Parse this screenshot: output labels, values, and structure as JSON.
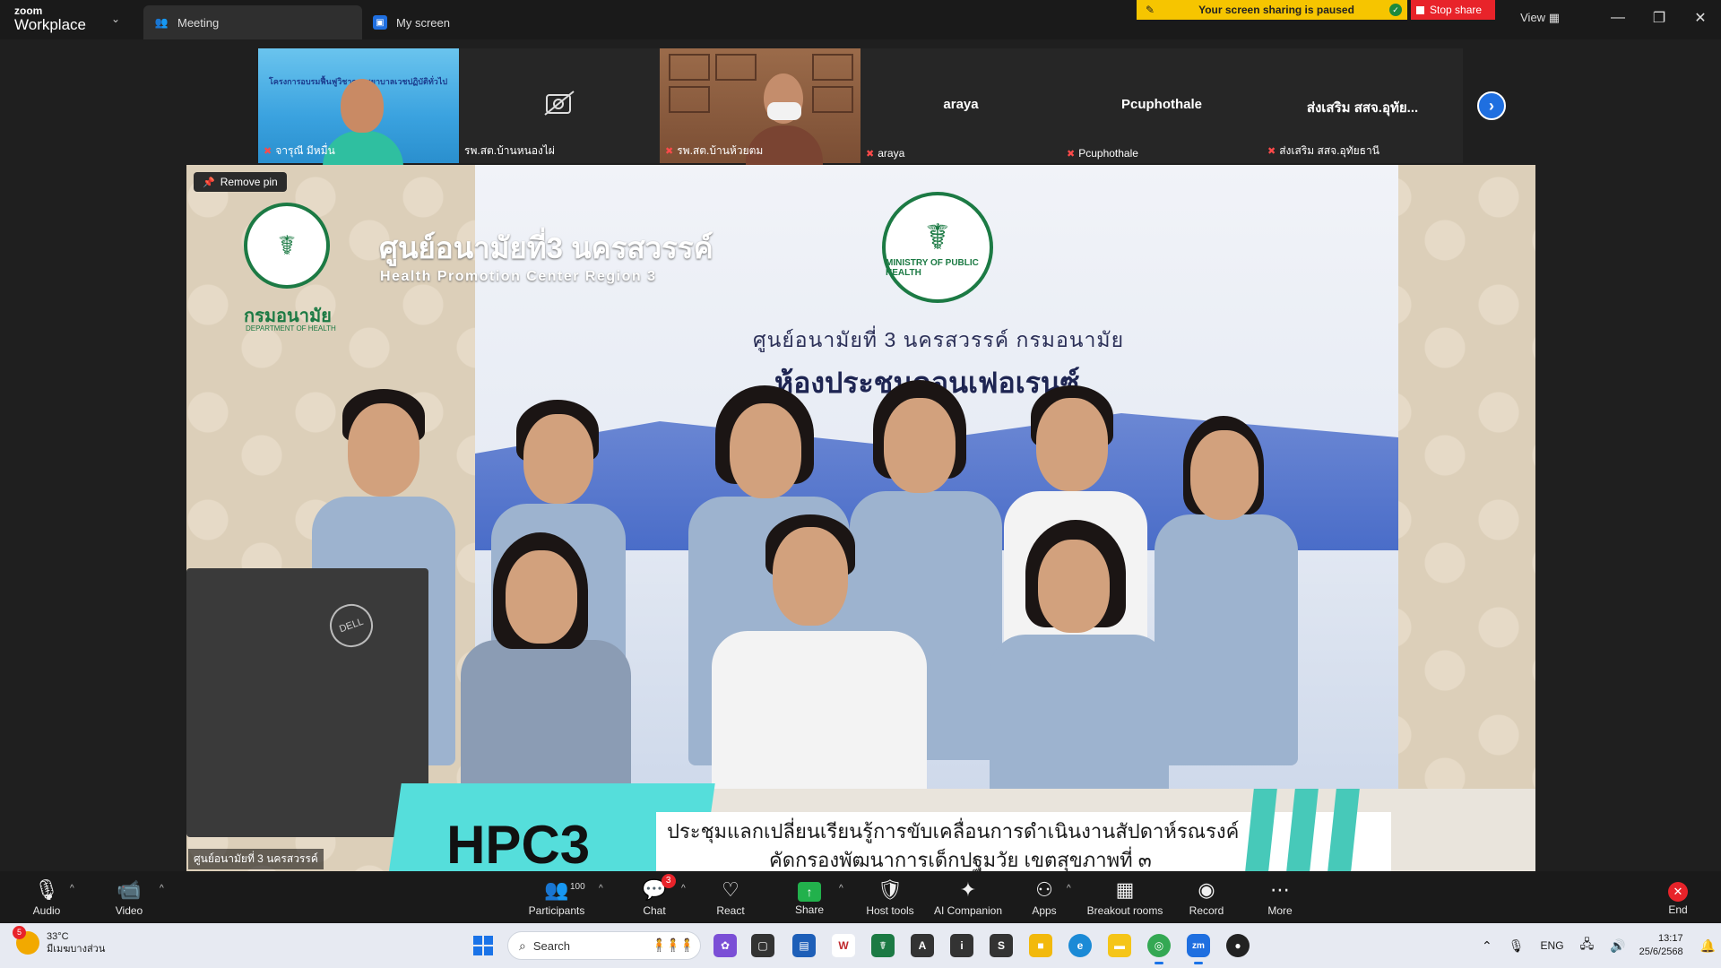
{
  "titlebar": {
    "brand_top": "zoom",
    "brand_bottom": "Workplace",
    "tabs": [
      {
        "label": "Meeting",
        "active": true
      },
      {
        "label": "My screen",
        "active": false
      }
    ],
    "share_banner": "Your screen sharing is paused",
    "stop_share": "Stop share",
    "view": "View"
  },
  "participants_strip": [
    {
      "name": "จารุณี มีหมื่น",
      "video": true,
      "muted": true,
      "banner": "โครงการอบรมฟื้นฟูวิชาการพยาบาลเวชปฏิบัติทั่วไป"
    },
    {
      "name": "รพ.สต.บ้านหนองไผ่",
      "video": false,
      "muted": false,
      "big_label": ""
    },
    {
      "name": "รพ.สต.บ้านห้วยตม",
      "video": true,
      "muted": true
    },
    {
      "name": "araya",
      "video": false,
      "muted": true,
      "big_label": "araya"
    },
    {
      "name": "Pcuphothale",
      "video": false,
      "muted": true,
      "big_label": "Pcuphothale"
    },
    {
      "name": "ส่งเสริม สสจ.อุทัยธานี",
      "video": false,
      "muted": true,
      "big_label": "ส่งเสริม สสจ.อุทัย..."
    }
  ],
  "main_video": {
    "remove_pin": "Remove pin",
    "speaker_name": "ศูนย์อนามัยที่ 3 นครสวรรค์",
    "hpc_title": "ศูนย์อนามัยที่3 นครสวรรค์",
    "hpc_subtitle": "Health Promotion Center Region 3",
    "dept_th": "กรมอนามัย",
    "dept_en": "DEPARTMENT OF HEALTH",
    "ministry_logo_text": "MINISTRY OF PUBLIC HEALTH",
    "room_line1": "ศูนย์อนามัยที่ 3 นครสวรรค์ กรมอนามัย",
    "room_line2": "ห้องประชุมคอนเฟอเรนซ์",
    "sign": "HPC3",
    "banner_line1": "ประชุมแลกเปลี่ยนเรียนรู้การขับเคลื่อนการดำเนินงานสัปดาห์รณรงค์",
    "banner_line2": "คัดกรองพัฒนาการเด็กปฐมวัย เขตสุขภาพที่ ๓",
    "monitor_brand": "DELL"
  },
  "toolbar": {
    "audio": "Audio",
    "video": "Video",
    "participants": "Participants",
    "participants_count": "100",
    "chat": "Chat",
    "chat_badge": "3",
    "react": "React",
    "share": "Share",
    "host_tools": "Host tools",
    "ai_companion": "AI Companion",
    "apps": "Apps",
    "breakout_rooms": "Breakout rooms",
    "record": "Record",
    "more": "More",
    "end": "End"
  },
  "taskbar": {
    "weather_badge": "5",
    "temperature": "33°C",
    "weather_desc": "มีเมฆบางส่วน",
    "search": "Search",
    "language": "ENG",
    "time": "13:17",
    "date": "25/6/2568"
  },
  "colors": {
    "accent": "#1f6fe0",
    "stop_red": "#e8232a",
    "banner_yellow": "#f6c500",
    "share_green": "#22b14c"
  }
}
